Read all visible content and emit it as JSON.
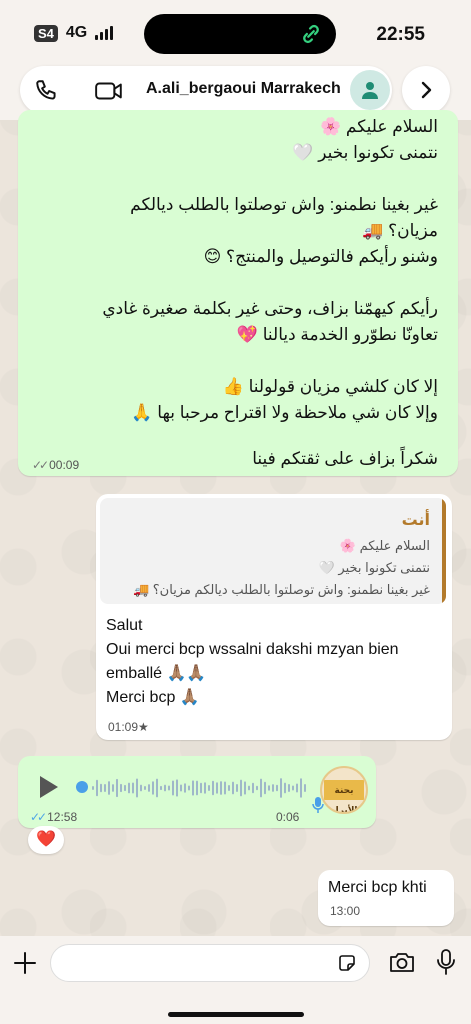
{
  "status_bar": {
    "sim": "S4",
    "network": "4G",
    "time": "22:55"
  },
  "header": {
    "contact_name": "A.ali_bergaoui Marrakech"
  },
  "messages": {
    "incoming_long": {
      "lines": [
        "السلام عليكم 🌸",
        "نتمنى تكونوا بخير 🤍",
        "",
        "غير بغينا نطمنو: واش توصلتوا بالطلب ديالكم",
        "مزيان؟ 🚚",
        "وشنو رأيكم فالتوصيل والمنتج؟ 😊",
        "",
        "رأيكم كيهمّنا بزاف، وحتى غير بكلمة صغيرة غادي",
        "تعاونّا نطوّرو الخدمة ديالنا 💖",
        "",
        "إلا كان كلشي مزيان قولولنا 👍",
        "وإلا كان شي ملاحظة ولا اقتراح مرحبا بها 🙏",
        "",
        "شكراً بزاف على ثقتكم فينا"
      ],
      "time": "00:09"
    },
    "reply": {
      "quote_author": "أنت",
      "quote_lines": [
        "السلام عليكم 🌸",
        "نتمنى تكونوا بخير 🤍",
        "غير بغينا نطمنو: واش توصلتوا بالطلب ديالكم مزيان؟ 🚚"
      ],
      "lines": [
        "Salut",
        "Oui merci bcp wssalni dakshi mzyan bien",
        "emballé 🙏🏽🙏🏽",
        "Merci bcp 🙏🏽"
      ],
      "time": "01:09★"
    },
    "voice": {
      "time": "12:58",
      "duration": "0:06",
      "avatar_text": "بحنة الأبرار"
    },
    "reaction": "❤️",
    "last": {
      "text": "Merci bcp khti",
      "time": "13:00"
    }
  },
  "colors": {
    "incoming_bubble": "#d9fdd3",
    "outgoing_bubble": "#ffffff",
    "read_ticks": "#4fa6e6",
    "quote_accent": "#b37a2b"
  }
}
